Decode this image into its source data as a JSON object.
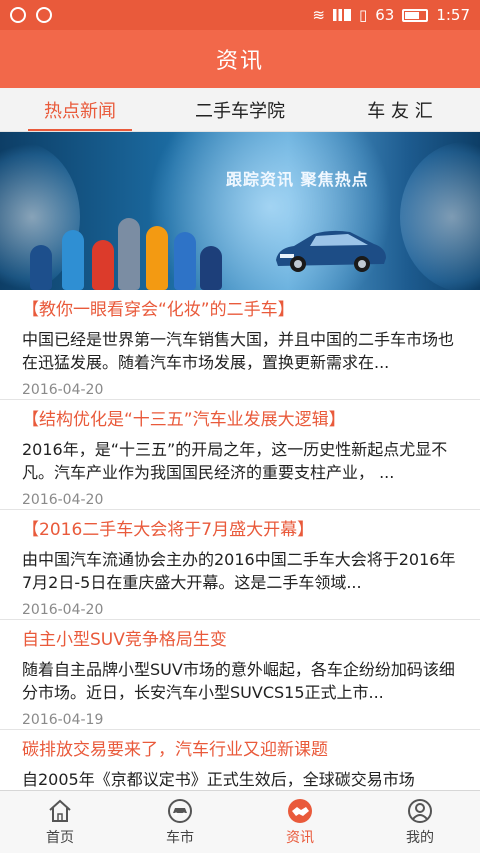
{
  "status_bar": {
    "battery": "63",
    "time": "1:57"
  },
  "app_bar": {
    "title": "资讯"
  },
  "tabs": [
    {
      "label": "热点新闻",
      "active": true
    },
    {
      "label": "二手车学院",
      "active": false
    },
    {
      "label": "车 友 汇",
      "active": false
    }
  ],
  "banner": {
    "text": "跟踪资讯  聚焦热点"
  },
  "news": [
    {
      "title": "【教你一眼看穿会“化妆”的二手车】",
      "summary": "中国已经是世界第一汽车销售大国，并且中国的二手车市场也在迅猛发展。随着汽车市场发展，置换更新需求在...",
      "date": "2016-04-20"
    },
    {
      "title": "【结构优化是“十三五”汽车业发展大逻辑】",
      "summary": "2016年，是“十三五”的开局之年，这一历史性新起点尤显不凡。汽车产业作为我国国民经济的重要支柱产业，  ...",
      "date": "2016-04-20"
    },
    {
      "title": "【2016二手车大会将于7月盛大开幕】",
      "summary": "由中国汽车流通协会主办的2016中国二手车大会将于2016年7月2日-5日在重庆盛大开幕。这是二手车领域...",
      "date": "2016-04-20"
    },
    {
      "title": "自主小型SUV竞争格局生变",
      "summary": "随着自主品牌小型SUV市场的意外崛起，各车企纷纷加码该细分市场。近日，长安汽车小型SUVCS15正式上市...",
      "date": "2016-04-19"
    },
    {
      "title": "碳排放交易要来了，汽车行业又迎新课题",
      "summary": "自2005年《京都议定书》正式生效后，全球碳交易市场",
      "date": ""
    }
  ],
  "bottom_nav": [
    {
      "label": "首页",
      "icon": "home-icon",
      "active": false
    },
    {
      "label": "车市",
      "icon": "car-icon",
      "active": false
    },
    {
      "label": "资讯",
      "icon": "handshake-icon",
      "active": true
    },
    {
      "label": "我的",
      "icon": "user-icon",
      "active": false
    }
  ],
  "colors": {
    "accent": "#e95a3b",
    "app_bar": "#f2684a"
  }
}
